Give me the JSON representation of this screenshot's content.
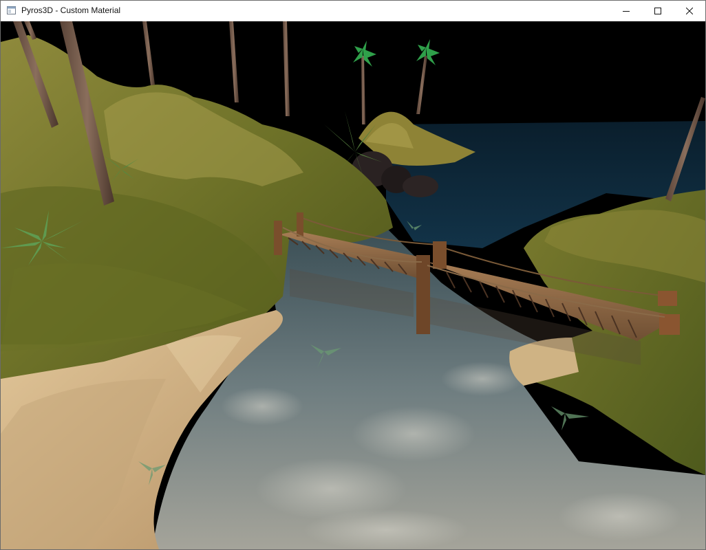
{
  "window": {
    "title": "Pyros3D - Custom Material",
    "controls": {
      "minimize_icon": "minimize-icon",
      "maximize_icon": "maximize-icon",
      "close_icon": "close-icon"
    }
  },
  "scene": {
    "description_icon": "app-window-icon",
    "colors": {
      "sky": "#000000",
      "grass_dark": "#4f5a1c",
      "grass_light": "#9a9440",
      "sand": "#d2b488",
      "water_deep": "#0d2a3d",
      "water_shallow": "#7f8e94",
      "wood": "#8a6240",
      "palm_leaf": "#2fa04a"
    }
  }
}
